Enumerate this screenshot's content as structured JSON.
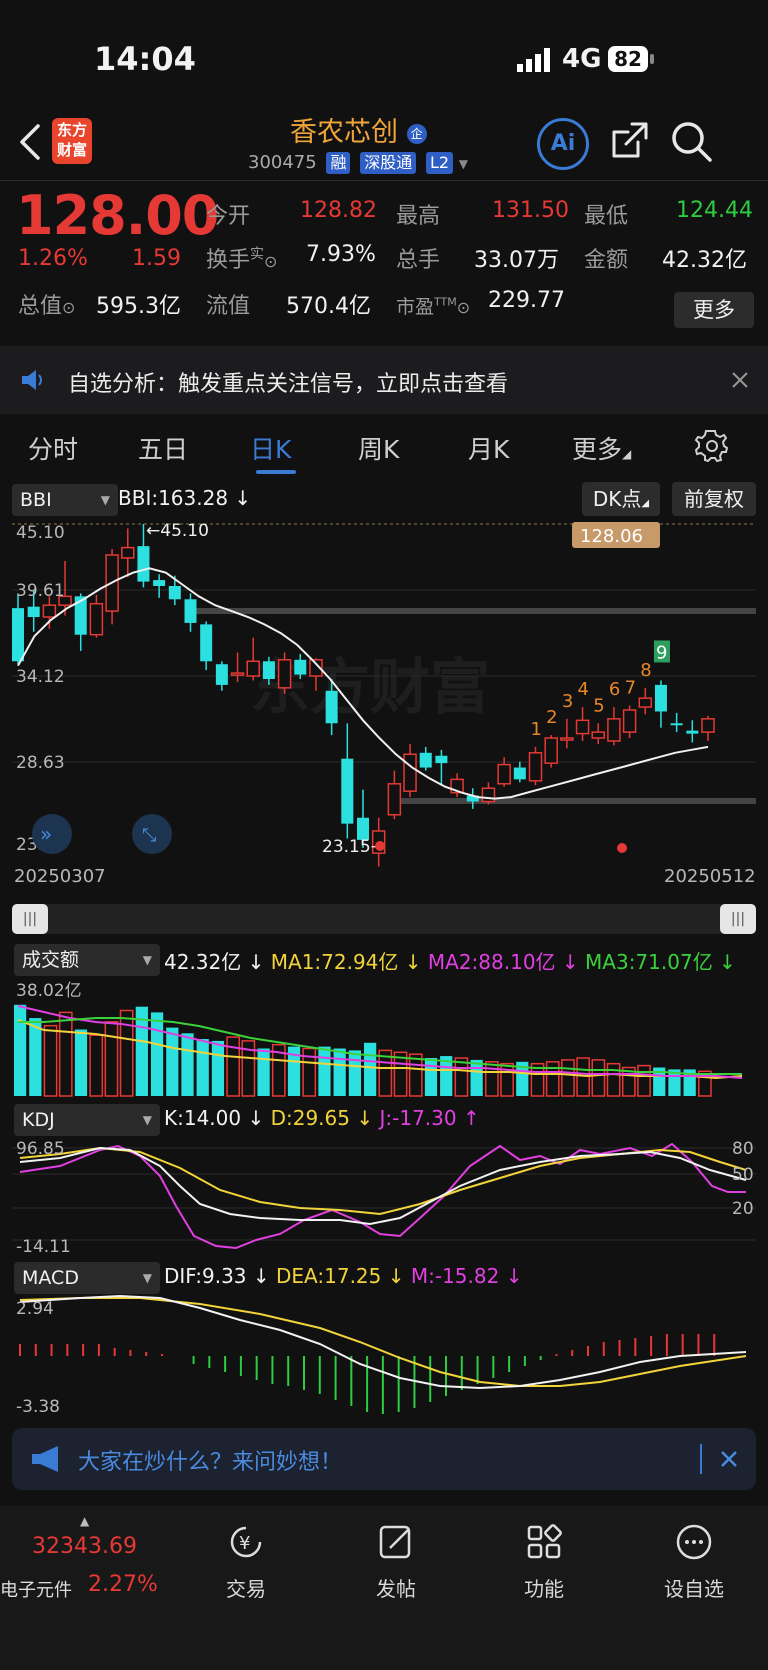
{
  "status": {
    "time": "14:04",
    "network": "4G",
    "battery": "82"
  },
  "header": {
    "logo_line1": "东方",
    "logo_line2": "财富",
    "stock_name": "香农芯创",
    "name_badge": "企",
    "stock_code": "300475",
    "tags": [
      "融",
      "深股通",
      "L2"
    ],
    "ai_label": "Ai"
  },
  "quote": {
    "price": "128.00",
    "change_pct": "1.26%",
    "change_abs": "1.59",
    "rows": [
      [
        {
          "label": "今开",
          "value": "128.82",
          "color": "red"
        },
        {
          "label": "最高",
          "value": "131.50",
          "color": "red"
        },
        {
          "label": "最低",
          "value": "124.44",
          "color": "green"
        }
      ],
      [
        {
          "label": "换手",
          "sup": "实",
          "value": "7.93%",
          "color": "white"
        },
        {
          "label": "总手",
          "value": "33.07万",
          "color": "white"
        },
        {
          "label": "金额",
          "value": "42.32亿",
          "color": "white"
        }
      ]
    ],
    "row3": {
      "total_label": "总值",
      "total_value": "595.3亿",
      "float_label": "流值",
      "float_value": "570.4亿",
      "pe_label": "市盈",
      "pe_sup": "TTM",
      "pe_value": "229.77"
    },
    "more_button": "更多"
  },
  "notice": {
    "text": "自选分析：触发重点关注信号，立即点击查看"
  },
  "tabs": {
    "items": [
      "分时",
      "五日",
      "日K",
      "周K",
      "月K",
      "更多"
    ],
    "active_index": 2
  },
  "kline_panel": {
    "indicator": "BBI",
    "legend": "BBI:163.28",
    "dk_button": "DK点",
    "adjust_button": "前复权",
    "price_tag": "128.06",
    "high_label": "45.10",
    "low_label": "23.15",
    "y_ticks": [
      "45.10",
      "39.61",
      "34.12",
      "28.63",
      "23.15"
    ],
    "date_start": "20250307",
    "date_end": "20250512",
    "watermark": "东方财富",
    "nine_turn": [
      "1",
      "2",
      "3",
      "4",
      "5",
      "6",
      "7",
      "8",
      "9"
    ]
  },
  "volume_panel": {
    "indicator": "成交额",
    "value": "42.32亿",
    "ma1": "MA1:72.94亿",
    "ma2": "MA2:88.10亿",
    "ma3": "MA3:71.07亿",
    "top_label": "38.02亿"
  },
  "kdj_panel": {
    "indicator": "KDJ",
    "k": "K:14.00",
    "d": "D:29.65",
    "j": "J:-17.30",
    "top_label": "96.85",
    "bottom_label": "-14.11",
    "right_ticks": [
      "80",
      "50",
      "20"
    ]
  },
  "macd_panel": {
    "indicator": "MACD",
    "dif": "DIF:9.33",
    "dea": "DEA:17.25",
    "m": "M:-15.82",
    "top_label": "2.94",
    "bottom_label": "-3.38"
  },
  "banner": {
    "text": "大家在炒什么？来问妙想！"
  },
  "bottom_nav": {
    "index_value": "32343.69",
    "index_name": "电子元件",
    "index_change": "2.27%",
    "items": [
      "交易",
      "发帖",
      "功能",
      "设自选"
    ]
  },
  "colors": {
    "up": "#e53935",
    "down": "#2de0e0",
    "bg": "#111111",
    "accent": "#3a7bd5"
  },
  "chart_data": {
    "type": "candlestick",
    "title": "",
    "x_start": "20250307",
    "x_end": "20250512",
    "ylim": [
      23.15,
      45.1
    ],
    "bbi": [
      35.5,
      37.5,
      38.6,
      39.4,
      40.0,
      40.7,
      41.3,
      41.8,
      42.1,
      41.8,
      41.0,
      40.2,
      39.6,
      39.2,
      38.8,
      38.3,
      37.7,
      36.9,
      35.8,
      34.6,
      33.2,
      31.8,
      30.6,
      29.5,
      28.6,
      27.9,
      27.3,
      26.9,
      26.6,
      26.5,
      26.6,
      26.9,
      27.2,
      27.5,
      27.8,
      28.1,
      28.4,
      28.7,
      29.0,
      29.3,
      29.6,
      29.8,
      30.0
    ],
    "candles": [
      {
        "o": 39.4,
        "c": 35.8,
        "h": 40.4,
        "l": 35.6
      },
      {
        "o": 39.5,
        "c": 38.8,
        "h": 40.6,
        "l": 37.8
      },
      {
        "o": 38.8,
        "c": 39.6,
        "h": 40.2,
        "l": 38.0
      },
      {
        "o": 39.6,
        "c": 40.2,
        "h": 42.6,
        "l": 38.9
      },
      {
        "o": 40.2,
        "c": 37.6,
        "h": 40.4,
        "l": 36.5
      },
      {
        "o": 37.6,
        "c": 39.7,
        "h": 40.3,
        "l": 37.4
      },
      {
        "o": 39.2,
        "c": 43.0,
        "h": 43.4,
        "l": 38.3
      },
      {
        "o": 42.8,
        "c": 43.5,
        "h": 44.8,
        "l": 41.5
      },
      {
        "o": 43.6,
        "c": 41.2,
        "h": 45.1,
        "l": 40.8
      },
      {
        "o": 41.3,
        "c": 40.9,
        "h": 41.7,
        "l": 40.1
      },
      {
        "o": 40.9,
        "c": 40.0,
        "h": 41.6,
        "l": 39.6
      },
      {
        "o": 40.0,
        "c": 38.4,
        "h": 40.4,
        "l": 37.8
      },
      {
        "o": 38.3,
        "c": 35.8,
        "h": 38.5,
        "l": 35.2
      },
      {
        "o": 35.6,
        "c": 34.2,
        "h": 35.8,
        "l": 33.8
      },
      {
        "o": 35.0,
        "c": 35.0,
        "h": 36.4,
        "l": 34.4
      },
      {
        "o": 34.8,
        "c": 35.8,
        "h": 37.4,
        "l": 34.5
      },
      {
        "o": 35.8,
        "c": 34.6,
        "h": 36.1,
        "l": 34.2
      },
      {
        "o": 34.0,
        "c": 35.9,
        "h": 36.4,
        "l": 33.6
      },
      {
        "o": 35.9,
        "c": 34.9,
        "h": 36.3,
        "l": 34.6
      },
      {
        "o": 34.8,
        "c": 35.9,
        "h": 36.0,
        "l": 33.8
      },
      {
        "o": 33.8,
        "c": 31.6,
        "h": 34.6,
        "l": 30.8
      },
      {
        "o": 29.2,
        "c": 24.8,
        "h": 31.6,
        "l": 23.8
      },
      {
        "o": 25.2,
        "c": 23.7,
        "h": 27.1,
        "l": 23.15
      },
      {
        "o": 22.8,
        "c": 24.3,
        "h": 25.2,
        "l": 21.9
      },
      {
        "o": 25.4,
        "c": 27.5,
        "h": 28.4,
        "l": 25.1
      },
      {
        "o": 27.0,
        "c": 29.5,
        "h": 30.2,
        "l": 26.6
      },
      {
        "o": 29.6,
        "c": 28.6,
        "h": 30.0,
        "l": 28.4
      },
      {
        "o": 29.4,
        "c": 28.9,
        "h": 29.8,
        "l": 27.4
      },
      {
        "o": 26.9,
        "c": 27.8,
        "h": 28.2,
        "l": 26.6
      },
      {
        "o": 26.7,
        "c": 26.3,
        "h": 27.2,
        "l": 25.8
      },
      {
        "o": 26.3,
        "c": 27.2,
        "h": 27.6,
        "l": 26.1
      },
      {
        "o": 27.5,
        "c": 28.8,
        "h": 29.3,
        "l": 27.3
      },
      {
        "o": 28.6,
        "c": 27.8,
        "h": 29.0,
        "l": 27.6
      },
      {
        "o": 27.7,
        "c": 29.6,
        "h": 30.0,
        "l": 27.4
      },
      {
        "o": 28.9,
        "c": 30.6,
        "h": 30.8,
        "l": 28.6
      },
      {
        "o": 30.6,
        "c": 30.6,
        "h": 31.9,
        "l": 29.9
      },
      {
        "o": 30.9,
        "c": 31.8,
        "h": 32.7,
        "l": 30.4
      },
      {
        "o": 30.6,
        "c": 31.0,
        "h": 31.6,
        "l": 30.2
      },
      {
        "o": 30.4,
        "c": 31.9,
        "h": 32.7,
        "l": 30.1
      },
      {
        "o": 31.0,
        "c": 32.5,
        "h": 32.8,
        "l": 30.6
      },
      {
        "o": 32.7,
        "c": 33.3,
        "h": 34.0,
        "l": 32.2
      },
      {
        "o": 34.2,
        "c": 32.4,
        "h": 34.5,
        "l": 31.3
      },
      {
        "o": 31.6,
        "c": 31.5,
        "h": 32.3,
        "l": 31.0
      },
      {
        "o": 31.1,
        "c": 30.9,
        "h": 31.8,
        "l": 30.3
      },
      {
        "o": 31.0,
        "c": 31.9,
        "h": 32.1,
        "l": 30.4
      }
    ]
  }
}
